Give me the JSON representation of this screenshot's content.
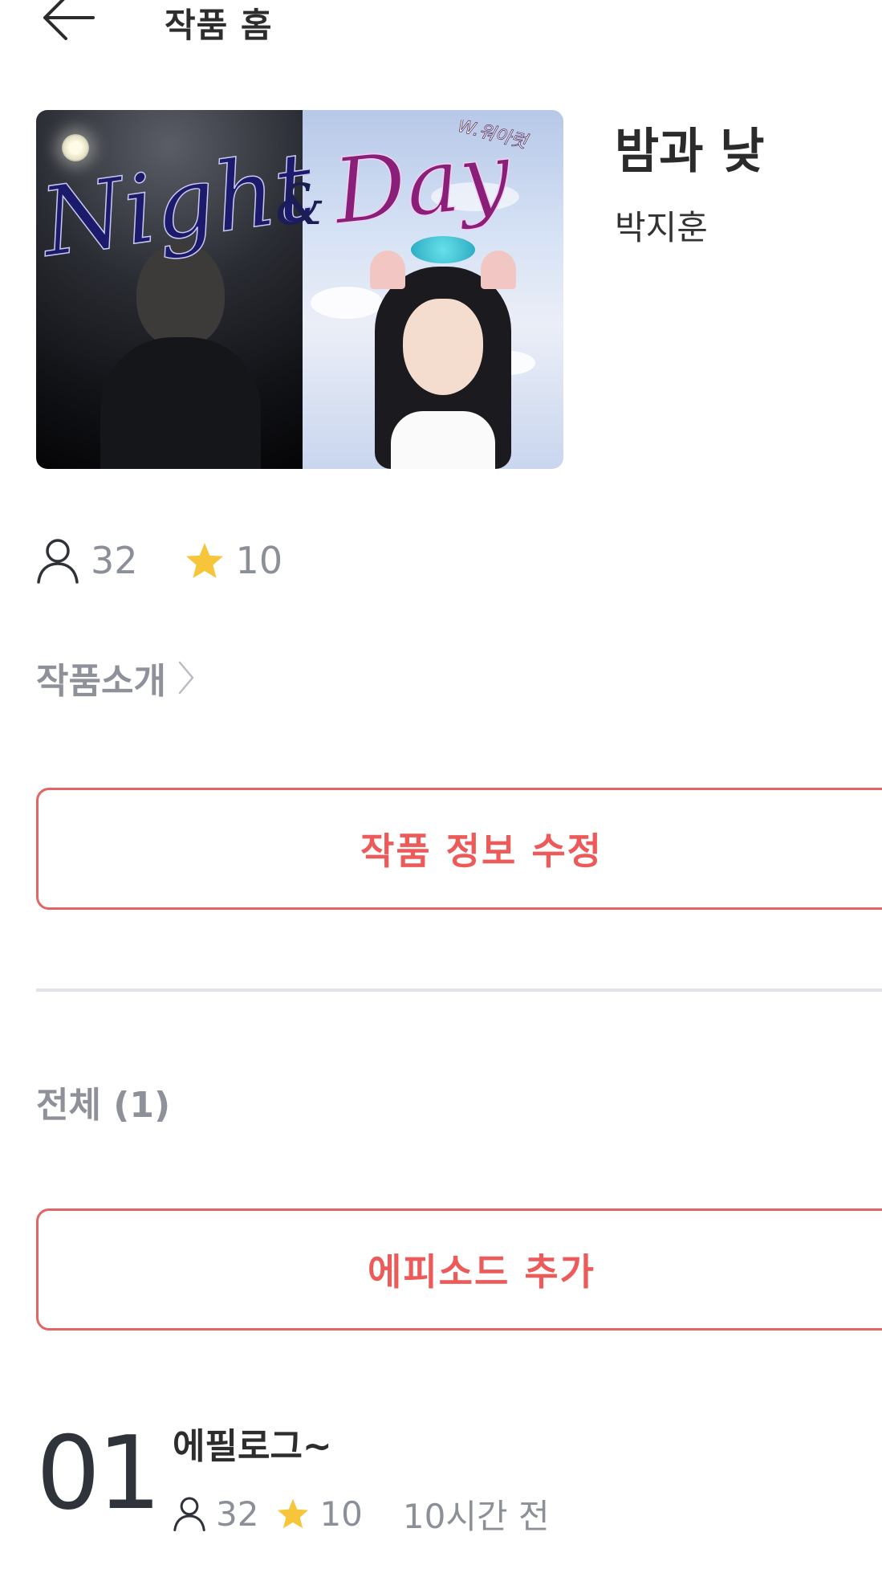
{
  "header": {
    "title": "작품 홈"
  },
  "work": {
    "title": "밤과 낮",
    "author": "박지훈",
    "cover_text": {
      "left": "Night",
      "amp": "&",
      "right": "Day",
      "credit": "W.워아럿"
    },
    "views": "32",
    "stars": "10"
  },
  "intro_link": {
    "label": "작품소개"
  },
  "edit_button": {
    "label": "작품 정보 수정"
  },
  "episodes_section": {
    "count_label": "전체 (1)"
  },
  "add_button": {
    "label": "에피소드 추가"
  },
  "episodes": [
    {
      "number": "01",
      "title": "에필로그~",
      "views": "32",
      "stars": "10",
      "time": "10시간 전"
    }
  ],
  "colors": {
    "accent": "#ec5b59",
    "star": "#f7c53a",
    "muted": "#8b8f98"
  }
}
